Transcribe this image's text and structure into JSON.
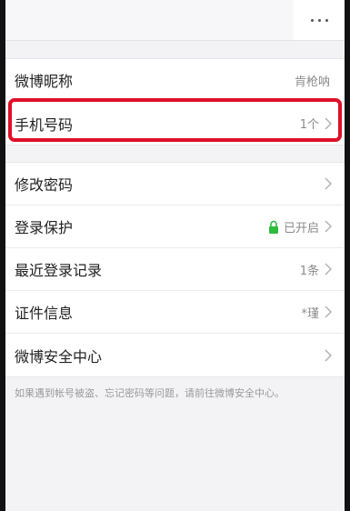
{
  "header": {
    "more_icon": "more-dots-icon"
  },
  "group1": [
    {
      "label": "微博昵称",
      "value": "肯枪呐",
      "chevron": false
    },
    {
      "label": "手机号码",
      "value": "1个",
      "chevron": true
    }
  ],
  "group2": [
    {
      "label": "修改密码",
      "value": "",
      "chevron": true
    },
    {
      "label": "登录保护",
      "value": "已开启",
      "chevron": true,
      "icon": "lock-icon",
      "icon_color": "#2dbb3e"
    },
    {
      "label": "最近登录记录",
      "value": "1条",
      "chevron": true
    },
    {
      "label": "证件信息",
      "value": "*瑾",
      "chevron": true
    },
    {
      "label": "微博安全中心",
      "value": "",
      "chevron": true
    }
  ],
  "footer_note": "如果遇到帐号被盗、忘记密码等问题，请前往微博安全中心。",
  "colors": {
    "highlight": "#e0102a",
    "background": "#f3f2f5"
  }
}
